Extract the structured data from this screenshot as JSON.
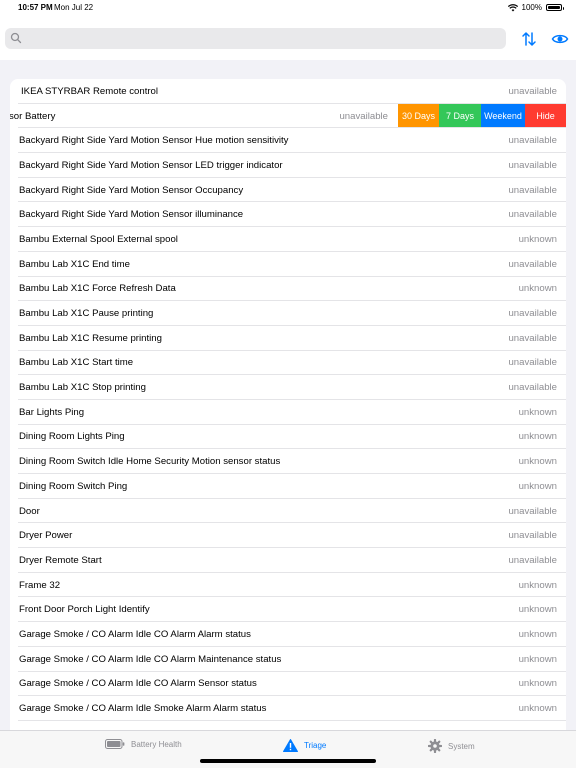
{
  "status_bar": {
    "time": "10:57 PM",
    "date": "Mon Jul 22",
    "battery": "100%"
  },
  "search": {
    "value": "",
    "placeholder": ""
  },
  "colors": {
    "accent": "#007aff",
    "orange": "#ff9500",
    "green": "#34c759",
    "red": "#ff3b30"
  },
  "rows": [
    {
      "name": "IKEA STYRBAR Remote control",
      "state": "unavailable"
    },
    {
      "name": "sor Battery",
      "state": "unavailable",
      "swiped": true
    },
    {
      "name": "Backyard Right Side Yard Motion Sensor Hue motion sensitivity",
      "state": "unavailable"
    },
    {
      "name": "Backyard Right Side Yard Motion Sensor LED trigger indicator",
      "state": "unavailable"
    },
    {
      "name": "Backyard Right Side Yard Motion Sensor Occupancy",
      "state": "unavailable"
    },
    {
      "name": "Backyard Right Side Yard Motion Sensor illuminance",
      "state": "unavailable"
    },
    {
      "name": "Bambu External Spool External spool",
      "state": "unknown"
    },
    {
      "name": "Bambu Lab X1C End time",
      "state": "unavailable"
    },
    {
      "name": "Bambu Lab X1C Force Refresh Data",
      "state": "unknown"
    },
    {
      "name": "Bambu Lab X1C Pause printing",
      "state": "unavailable"
    },
    {
      "name": "Bambu Lab X1C Resume printing",
      "state": "unavailable"
    },
    {
      "name": "Bambu Lab X1C Start time",
      "state": "unavailable"
    },
    {
      "name": "Bambu Lab X1C Stop printing",
      "state": "unavailable"
    },
    {
      "name": "Bar Lights Ping",
      "state": "unknown"
    },
    {
      "name": "Dining Room Lights Ping",
      "state": "unknown"
    },
    {
      "name": "Dining Room Switch Idle Home Security Motion sensor status",
      "state": "unknown"
    },
    {
      "name": "Dining Room Switch Ping",
      "state": "unknown"
    },
    {
      "name": "Door",
      "state": "unavailable"
    },
    {
      "name": "Dryer Power",
      "state": "unavailable"
    },
    {
      "name": "Dryer Remote Start",
      "state": "unavailable"
    },
    {
      "name": "Frame 32",
      "state": "unknown"
    },
    {
      "name": "Front Door Porch Light Identify",
      "state": "unknown"
    },
    {
      "name": "Garage Smoke / CO Alarm Idle CO Alarm Alarm status",
      "state": "unknown"
    },
    {
      "name": "Garage Smoke / CO Alarm Idle CO Alarm Maintenance status",
      "state": "unknown"
    },
    {
      "name": "Garage Smoke / CO Alarm Idle CO Alarm Sensor status",
      "state": "unknown"
    },
    {
      "name": "Garage Smoke / CO Alarm Idle Smoke Alarm Alarm status",
      "state": "unknown"
    }
  ],
  "swipe_actions": {
    "thirty_days": "30 Days",
    "seven_days": "7 Days",
    "weekend": "Weekend",
    "hide": "Hide"
  },
  "tabs": {
    "battery": "Battery Health",
    "triage": "Triage",
    "system": "System"
  }
}
